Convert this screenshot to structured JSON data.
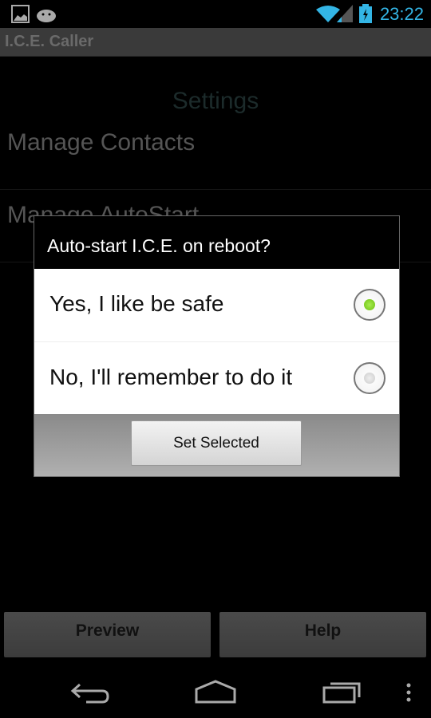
{
  "status_bar": {
    "time": "23:22",
    "icons": [
      "picture-icon",
      "android-icon",
      "wifi-icon",
      "signal-icon",
      "battery-charging-icon"
    ],
    "accent": "#33b5e5"
  },
  "app": {
    "title": "I.C.E. Caller"
  },
  "main": {
    "heading": "Settings",
    "items": [
      {
        "label": "Manage Contacts"
      },
      {
        "label": "Manage AutoStart"
      }
    ]
  },
  "bottom_buttons": {
    "preview": "Preview",
    "help": "Help"
  },
  "dialog": {
    "title": "Auto-start I.C.E. on reboot?",
    "options": [
      {
        "label": "Yes, I like be safe",
        "selected": true
      },
      {
        "label": "No, I'll remember to do it",
        "selected": false
      }
    ],
    "button": "Set Selected",
    "selected_color": "#7ccd1c"
  },
  "nav": {
    "icons": [
      "back-icon",
      "home-icon",
      "recent-apps-icon",
      "overflow-menu-icon"
    ]
  }
}
